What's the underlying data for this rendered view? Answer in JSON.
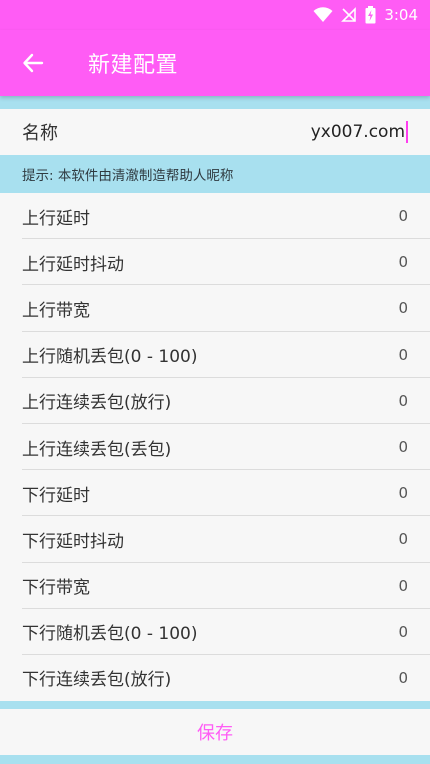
{
  "status_bar": {
    "time": "3:04",
    "icons": [
      "wifi-icon",
      "no-signal-icon",
      "battery-charging-icon"
    ]
  },
  "app_bar": {
    "back_icon": "arrow-left-icon",
    "title": "新建配置"
  },
  "name_field": {
    "label": "名称",
    "value": "yx007.com"
  },
  "hint": {
    "text": "提示: 本软件由清澈制造帮助人昵称"
  },
  "settings": [
    {
      "label": "上行延时",
      "value": "0"
    },
    {
      "label": "上行延时抖动",
      "value": "0"
    },
    {
      "label": "上行带宽",
      "value": "0"
    },
    {
      "label": "上行随机丢包(0 - 100)",
      "value": "0"
    },
    {
      "label": "上行连续丢包(放行)",
      "value": "0"
    },
    {
      "label": "上行连续丢包(丢包)",
      "value": "0"
    },
    {
      "label": "下行延时",
      "value": "0"
    },
    {
      "label": "下行延时抖动",
      "value": "0"
    },
    {
      "label": "下行带宽",
      "value": "0"
    },
    {
      "label": "下行随机丢包(0 - 100)",
      "value": "0"
    },
    {
      "label": "下行连续丢包(放行)",
      "value": "0"
    }
  ],
  "save_button": {
    "label": "保存"
  },
  "colors": {
    "app_bar": "#ff5cf5",
    "hint_background": "#a8e0ef",
    "save_text": "#ff5cf5"
  }
}
